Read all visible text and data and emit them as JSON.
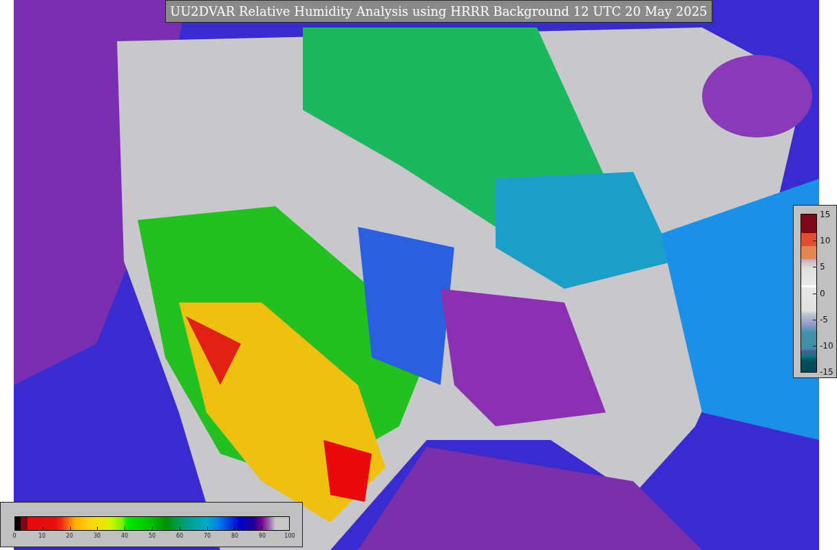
{
  "title": "UU2DVAR Relative Humidity Analysis using HRRR Background 12 UTC 20 May 2025",
  "humidity_colorbar": {
    "ticks": [
      "0",
      "10",
      "20",
      "30",
      "40",
      "50",
      "60",
      "70",
      "80",
      "90",
      "100"
    ]
  },
  "difference_colorbar": {
    "ticks": [
      "15",
      "10",
      "5",
      "0",
      "-5",
      "-10",
      "-15"
    ]
  }
}
